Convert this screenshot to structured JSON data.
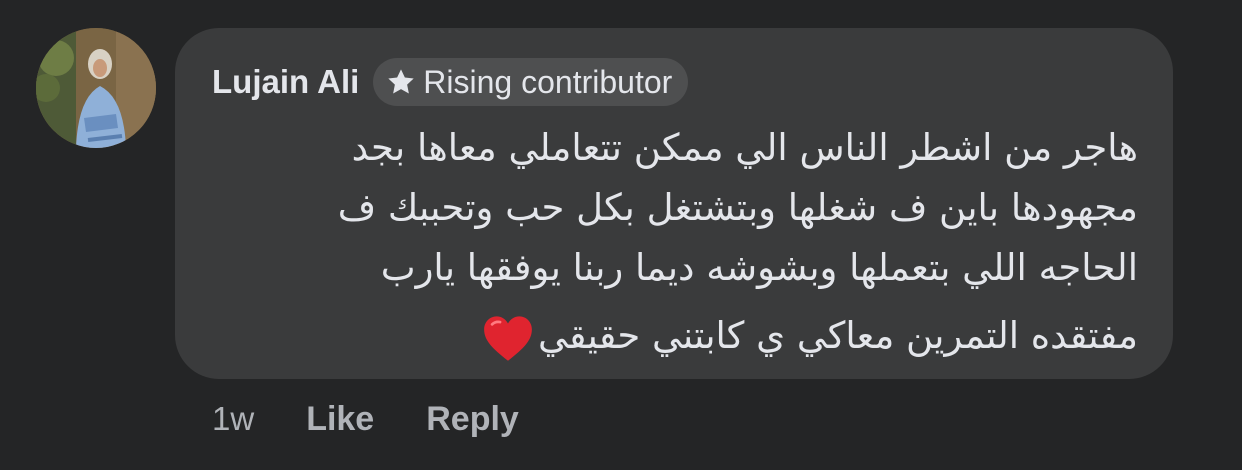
{
  "comment": {
    "author": "Lujain Ali",
    "badge": {
      "icon": "star-icon",
      "label": "Rising contributor"
    },
    "text_lines": [
      "هاجر من اشطر الناس الي ممكن تتعاملي معاها بجد",
      "مجهودها باين ف شغلها وبتشتغل بكل حب وتحببك ف",
      "الحاجه اللي بتعملها وبشوشه ديما ربنا يوفقها يارب",
      "مفتقده التمرين معاكي ي كابتني حقيقي"
    ],
    "emoji": "heart-icon",
    "time": "1w",
    "actions": {
      "like": "Like",
      "reply": "Reply"
    }
  },
  "colors": {
    "background": "#242526",
    "bubble": "#3a3b3c",
    "text": "#e4e6eb",
    "secondary_text": "#b0b3b8",
    "heart": "#e0242f"
  }
}
